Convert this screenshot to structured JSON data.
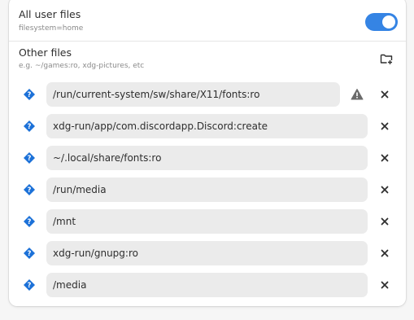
{
  "all_user_files": {
    "title": "All user files",
    "subtitle": "filesystem=home",
    "enabled": true
  },
  "other_files": {
    "title": "Other files",
    "subtitle": "e.g. ~/games:ro, xdg-pictures, etc",
    "add_icon": "folder-add-icon"
  },
  "entries": [
    {
      "path": "/run/current-system/sw/share/X11/fonts:ro",
      "warning": true
    },
    {
      "path": "xdg-run/app/com.discordapp.Discord:create",
      "warning": false
    },
    {
      "path": "~/.local/share/fonts:ro",
      "warning": false
    },
    {
      "path": "/run/media",
      "warning": false
    },
    {
      "path": "/mnt",
      "warning": false
    },
    {
      "path": "xdg-run/gnupg:ro",
      "warning": false
    },
    {
      "path": "/media",
      "warning": false
    }
  ],
  "icons": {
    "help": "help-diamond-icon",
    "warning": "warning-triangle-icon",
    "remove": "close-icon"
  },
  "colors": {
    "accent": "#3584e4",
    "help_icon": "#1c71d8"
  }
}
